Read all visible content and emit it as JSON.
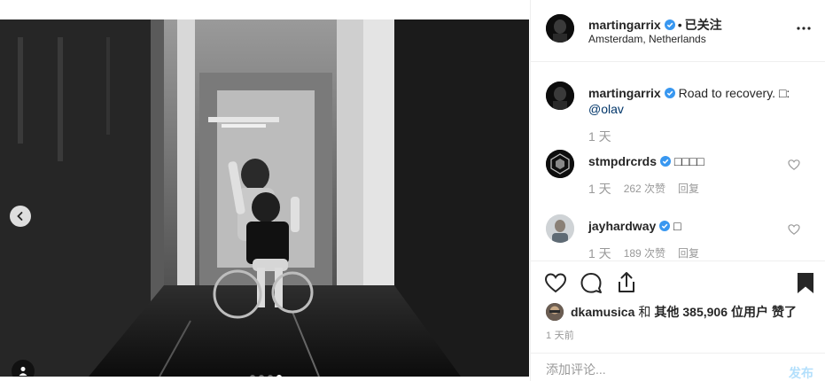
{
  "post": {
    "username": "martingarrix",
    "follow_separator": "•",
    "follow_state": "已关注",
    "location": "Amsterdam, Netherlands"
  },
  "carousel": {
    "slide_count": 4,
    "active_slide": 4
  },
  "comments": [
    {
      "username": "martingarrix",
      "text": "Road to recovery. ",
      "glyph": "□",
      "text_after": ":",
      "mention": "@olav",
      "time": "1 天",
      "likes": "",
      "reply": ""
    },
    {
      "username": "stmpdrcrds",
      "text": "□□□□",
      "time": "1 天",
      "likes": "262 次赞",
      "reply": "回复"
    },
    {
      "username": "jayhardway",
      "text": "□",
      "time": "1 天",
      "likes": "189 次赞",
      "reply": "回复"
    }
  ],
  "likes": {
    "first_user": "dkamusica",
    "connector": "和",
    "others_label": "其他",
    "count": "385,906",
    "suffix": "位用户",
    "action": "赞了"
  },
  "posted": "1 天前",
  "comment_box": {
    "placeholder": "添加评论...",
    "post_label": "发布"
  },
  "colors": {
    "verified": "#3897f0",
    "link": "#003569",
    "post_disabled": "#b2dffc"
  }
}
